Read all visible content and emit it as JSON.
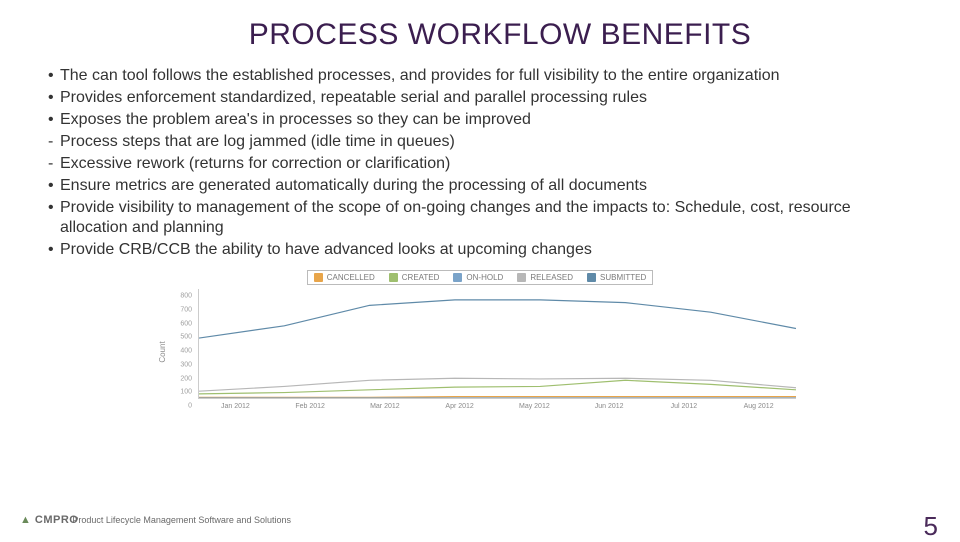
{
  "title": "PROCESS WORKFLOW BENEFITS",
  "bullets": {
    "b0": "The can tool follows the established processes, and provides for full visibility to the entire organization",
    "b1": "Provides enforcement standardized, repeatable serial and parallel processing rules",
    "b2": "Exposes the problem area's in processes so they can be improved",
    "b2s0": "Process steps that are log jammed (idle time in queues)",
    "b2s1": "Excessive rework (returns for correction or clarification)",
    "b3": "Ensure metrics are generated automatically during the processing of all documents",
    "b4": "Provide visibility to management of the scope of on-going changes and the impacts to: Schedule, cost, resource allocation and planning",
    "b5": "Provide CRB/CCB the ability to have advanced looks at upcoming changes"
  },
  "footer": {
    "logo_mark": "▲",
    "logo_text": "CMPRO",
    "tagline": "Product Lifecycle Management Software and Solutions"
  },
  "page_number": "5",
  "chart_data": {
    "type": "line",
    "ylabel": "Count",
    "ylim": [
      0,
      800
    ],
    "y_ticks": [
      0,
      100,
      200,
      300,
      400,
      500,
      600,
      700,
      800
    ],
    "categories": [
      "Jan 2012",
      "Feb 2012",
      "Mar 2012",
      "Apr 2012",
      "May 2012",
      "Jun 2012",
      "Jul 2012",
      "Aug 2012"
    ],
    "series": [
      {
        "name": "CANCELLED",
        "color": "#e8a54a",
        "values": [
          5,
          5,
          5,
          10,
          10,
          10,
          10,
          10
        ]
      },
      {
        "name": "CREATED",
        "color": "#9fbf6f",
        "values": [
          30,
          40,
          60,
          80,
          85,
          130,
          100,
          60
        ]
      },
      {
        "name": "ON-HOLD",
        "color": "#7aa3c9",
        "values": [
          0,
          0,
          0,
          0,
          0,
          0,
          0,
          0
        ]
      },
      {
        "name": "RELEASED",
        "color": "#b7b7b7",
        "values": [
          50,
          85,
          130,
          145,
          140,
          145,
          130,
          75
        ]
      },
      {
        "name": "SUBMITTED",
        "color": "#5f8aa8",
        "values": [
          440,
          530,
          680,
          720,
          720,
          700,
          630,
          510
        ]
      }
    ]
  }
}
